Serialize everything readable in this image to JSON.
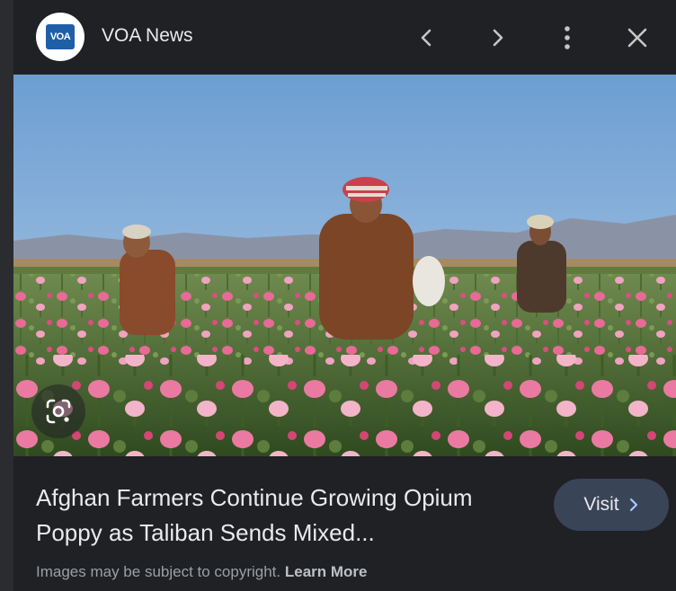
{
  "header": {
    "logo_text": "VOA",
    "source_name": "VOA News",
    "icons": [
      "chevron-left-icon",
      "chevron-right-icon",
      "more-vert-icon",
      "close-icon"
    ]
  },
  "image": {
    "alt": "Afghan farmers working in a field of pink opium poppies",
    "lens_icon": "google-lens-icon"
  },
  "caption": {
    "title": "Afghan Farmers Continue Growing Opium Poppy as Taliban Sends Mixed...",
    "visit_label": "Visit",
    "copyright_text": "Images may be subject to copyright.",
    "learn_more": "Learn More"
  },
  "colors": {
    "background": "#202124",
    "visit_button": "#394457",
    "text_primary": "#e8eaed",
    "text_secondary": "#9aa0a6"
  }
}
